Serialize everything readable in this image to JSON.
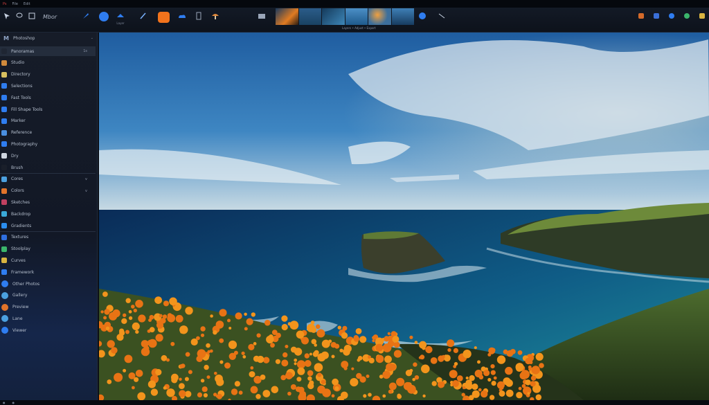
{
  "menubar": {
    "items": [
      "Ps",
      "File",
      "Edit"
    ]
  },
  "toolbar": {
    "app_title": "Mbor",
    "tool_label": "Layer",
    "strip_caption": "Layers  •  Adjust  •  Export"
  },
  "sidebar": {
    "header": {
      "logo": "M",
      "title": "Photoshop"
    },
    "items": [
      {
        "label": "Panoramas",
        "tail": "1s"
      },
      {
        "label": "Studio"
      },
      {
        "label": "Directory"
      },
      {
        "label": "Selections"
      },
      {
        "label": "Fast Tools"
      },
      {
        "label": "Fill Shape Tools"
      },
      {
        "label": "Marker"
      },
      {
        "label": "Reference"
      },
      {
        "label": "Photography"
      },
      {
        "label": "Dry"
      },
      {
        "label": "Brush"
      },
      {
        "label": "Cores",
        "tail": "v"
      },
      {
        "label": "Colors",
        "tail": "v"
      },
      {
        "label": "Sketches"
      },
      {
        "label": "Backdrop"
      },
      {
        "label": "Gradients"
      },
      {
        "label": "Textures"
      },
      {
        "label": "Stoolplay"
      },
      {
        "label": "Curves"
      },
      {
        "label": "Framework"
      },
      {
        "label": "Other Photos"
      },
      {
        "label": "Gallery"
      },
      {
        "label": "Preview"
      },
      {
        "label": "Lane"
      },
      {
        "label": "Viewer"
      }
    ]
  },
  "colors": {
    "accent_blue": "#2f7df0",
    "accent_orange": "#f2731c"
  }
}
